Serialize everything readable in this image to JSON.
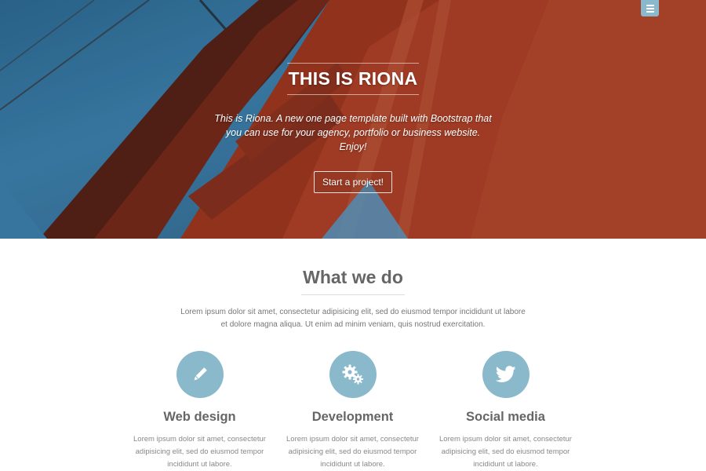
{
  "nav": {
    "menu_icon": "hamburger-menu-icon"
  },
  "hero": {
    "title": "THIS IS RIONA",
    "subtitle": "This is Riona. A new one page template built with Bootstrap that you can use for your agency, portfolio or business website. Enjoy!",
    "cta_label": "Start a project!",
    "background": "golden-gate-bridge-tower-photo"
  },
  "services": {
    "title": "What we do",
    "intro": "Lorem ipsum dolor sit amet, consectetur adipisicing elit, sed do eiusmod tempor incididunt ut labore et dolore magna aliqua. Ut enim ad minim veniam, quis nostrud exercitation.",
    "items": [
      {
        "icon": "pencil-icon",
        "title": "Web design",
        "text": "Lorem ipsum dolor sit amet, consectetur adipisicing elit, sed do eiusmod tempor incididunt ut labore."
      },
      {
        "icon": "gears-icon",
        "title": "Development",
        "text": "Lorem ipsum dolor sit amet, consectetur adipisicing elit, sed do eiusmod tempor incididunt ut labore."
      },
      {
        "icon": "twitter-icon",
        "title": "Social media",
        "text": "Lorem ipsum dolor sit amet, consectetur adipisicing elit, sed do eiusmod tempor incididunt ut labore."
      }
    ]
  },
  "colors": {
    "accent": "#8ab9cc",
    "heading": "#666666",
    "text": "#888888",
    "sky": "#3f86b5",
    "bridge": "#b5422a"
  }
}
